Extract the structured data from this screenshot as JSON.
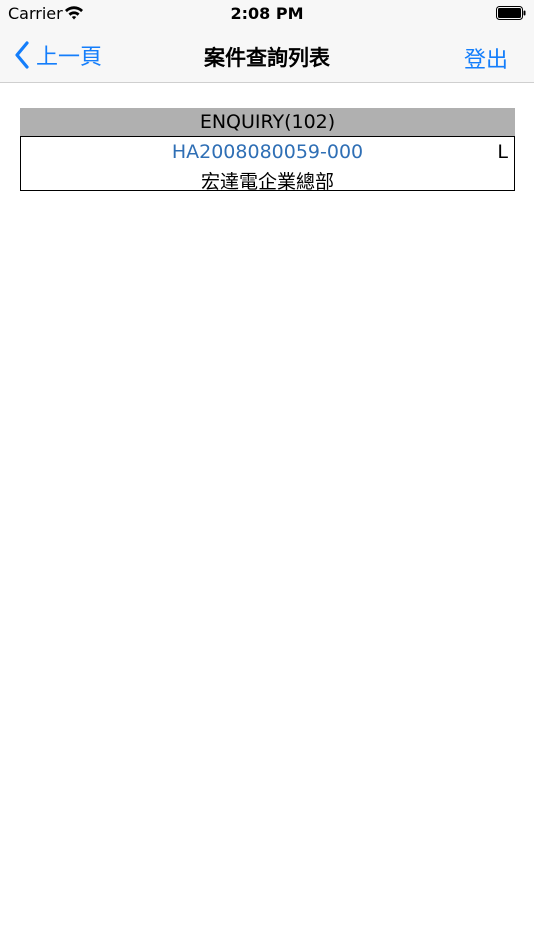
{
  "status_bar": {
    "carrier": "Carrier",
    "time": "2:08 PM"
  },
  "nav": {
    "back_label": "上一頁",
    "title": "案件查詢列表",
    "logout_label": "登出"
  },
  "table": {
    "header": "ENQUIRY(102)",
    "rows": [
      {
        "case_id": "HA2008080059-000",
        "tag": "L",
        "name": "宏達電企業總部"
      }
    ]
  },
  "colors": {
    "accent": "#147efb",
    "link": "#2f6fb5",
    "header_bg": "#b0b0b0",
    "bar_bg": "#f7f7f7"
  },
  "icons": {
    "wifi": "wifi-icon",
    "battery": "battery-icon",
    "back": "chevron-left-icon"
  }
}
